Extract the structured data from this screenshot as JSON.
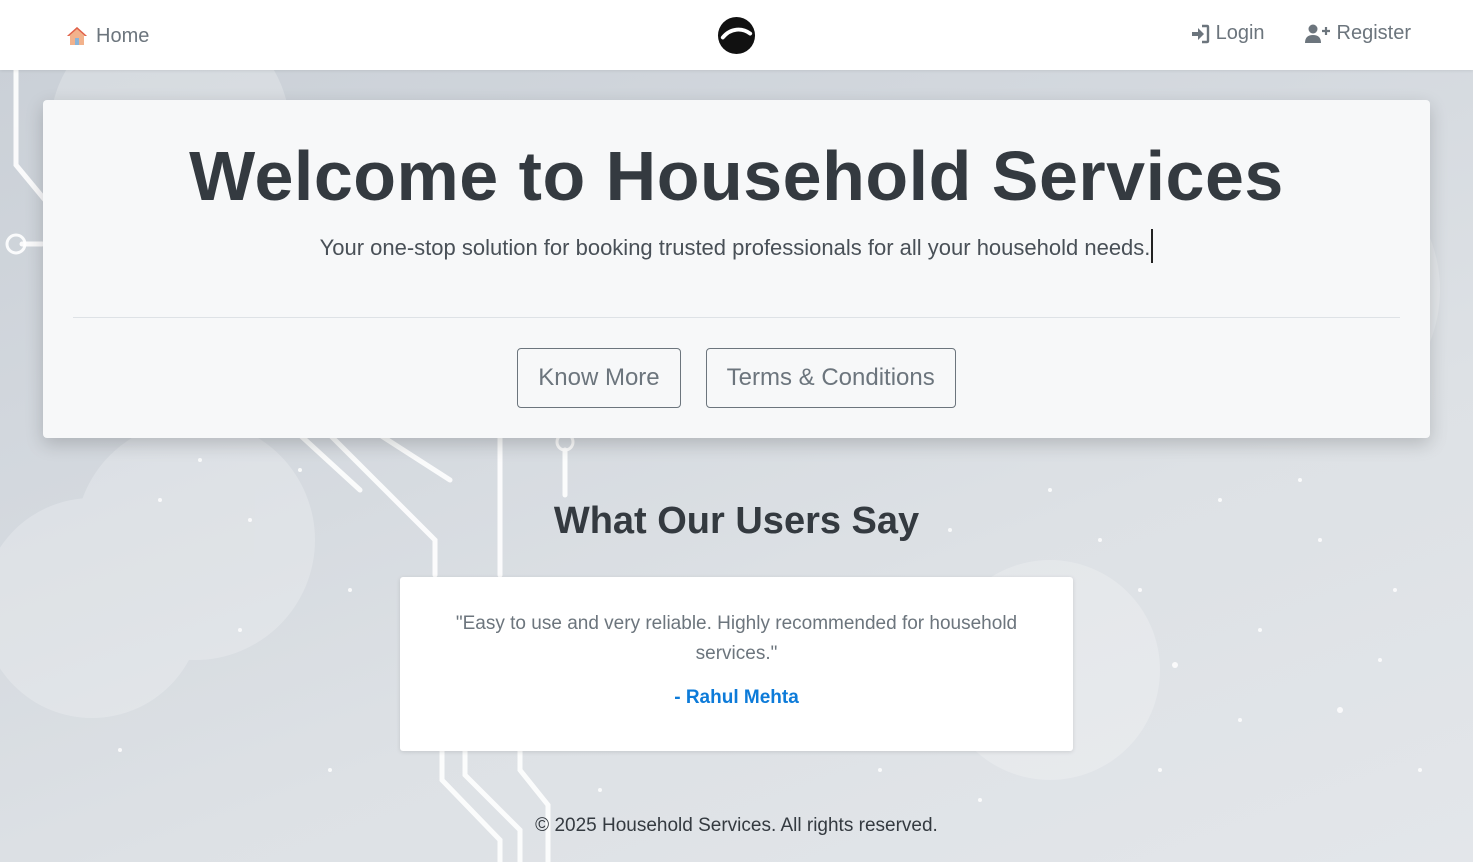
{
  "navbar": {
    "home_label": "Home",
    "login_label": "Login",
    "register_label": "Register",
    "home_icon": "house-icon",
    "logo_icon": "logo-icon",
    "login_icon": "sign-in-icon",
    "register_icon": "user-plus-icon"
  },
  "hero": {
    "title": "Welcome to Household Services",
    "lead": "Your one-stop solution for booking trusted professionals for all your household needs.",
    "know_more_label": "Know More",
    "terms_label": "Terms & Conditions"
  },
  "testimonials": {
    "heading": "What Our Users Say",
    "items": [
      {
        "quote": "\"Easy to use and very reliable. Highly recommended for household services.\"",
        "author": "- Rahul Mehta"
      }
    ]
  },
  "footer": {
    "copyright": "© 2025 Household Services. All rights reserved."
  },
  "colors": {
    "accent": "#0d7bd9",
    "text_dark": "#343a40",
    "text_muted": "#6c757d",
    "navbar_bg": "#ffffff",
    "card_bg": "#f7f8f9"
  }
}
